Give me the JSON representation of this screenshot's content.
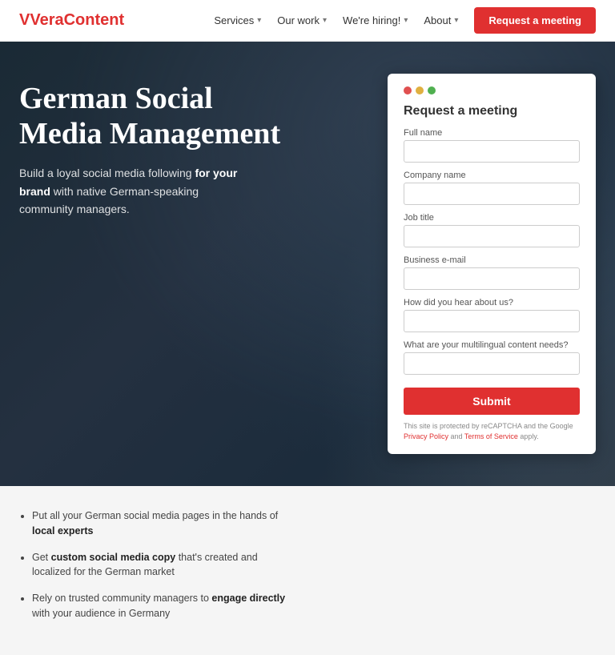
{
  "header": {
    "logo_prefix": "Vera",
    "logo_suffix": "Content",
    "nav_items": [
      {
        "label": "Services",
        "has_dropdown": true
      },
      {
        "label": "Our work",
        "has_dropdown": true
      },
      {
        "label": "We're hiring!",
        "has_dropdown": true
      },
      {
        "label": "About",
        "has_dropdown": true
      }
    ],
    "cta_label": "Request a meeting"
  },
  "hero": {
    "title": "German Social Media Management",
    "subtitle_part1": "Build a loyal social media following ",
    "subtitle_bold1": "for your brand",
    "subtitle_part2": " with native German-speaking community managers."
  },
  "form": {
    "title": "Request a meeting",
    "fields": [
      {
        "id": "full-name",
        "label": "Full name",
        "placeholder": ""
      },
      {
        "id": "company-name",
        "label": "Company name",
        "placeholder": ""
      },
      {
        "id": "job-title",
        "label": "Job title",
        "placeholder": ""
      },
      {
        "id": "business-email",
        "label": "Business e-mail",
        "placeholder": ""
      },
      {
        "id": "how-hear",
        "label": "How did you hear about us?",
        "placeholder": ""
      },
      {
        "id": "content-needs",
        "label": "What are your multilingual content needs?",
        "placeholder": ""
      }
    ],
    "submit_label": "Submit",
    "footer_text": "This site is protected by reCAPTCHA and the Google ",
    "privacy_label": "Privacy Policy",
    "footer_and": " and ",
    "tos_label": "Terms of Service",
    "footer_suffix": " apply."
  },
  "lower": {
    "items": [
      {
        "text_before": "Put all your German social media pages in the hands of ",
        "text_bold": "local experts",
        "text_after": ""
      },
      {
        "text_before": "Get ",
        "text_bold": "custom social media copy",
        "text_after": " that's created and localized for the German market"
      },
      {
        "text_before": "Rely on trusted community managers to ",
        "text_bold": "engage directly",
        "text_after": " with your audience in Germany"
      }
    ]
  }
}
